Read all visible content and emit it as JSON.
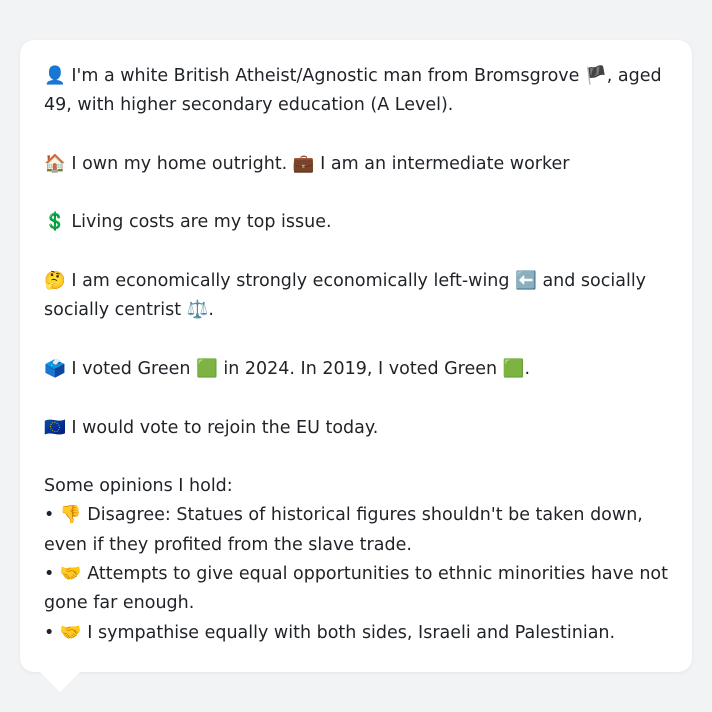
{
  "profile": {
    "intro": {
      "emoji": "👤",
      "text_before_flag": " I'm a white British Atheist/Agnostic man from Bromsgrove ",
      "flag": "🏴",
      "text_after_flag": ", aged 49, with higher secondary education (A Level)."
    },
    "home": {
      "emoji_house": "🏠",
      "text_house": " I own my home outright. ",
      "emoji_work": "💼",
      "text_work": " I am an intermediate worker"
    },
    "issue": {
      "emoji": "💲",
      "text": " Living costs are my top issue."
    },
    "politics": {
      "emoji": "🤔",
      "text_before": " I am economically strongly economically left-wing ",
      "emoji_left": "⬅️",
      "text_middle": " and socially socially centrist ",
      "emoji_scale": "⚖️",
      "text_end": "."
    },
    "vote": {
      "emoji": "🗳️",
      "text_1": " I voted Green ",
      "emoji_green_1": "🟩",
      "text_2": " in 2024. In 2019, I voted Green ",
      "emoji_green_2": "🟩",
      "text_3": "."
    },
    "eu": {
      "emoji": "🇪🇺",
      "text": " I would vote to rejoin the EU today."
    },
    "opinions": {
      "heading": "Some opinions I hold:",
      "items": [
        {
          "bullet": "• ",
          "emoji": "👎",
          "text": " Disagree: Statues of historical figures shouldn't be taken down, even if they profited from the slave trade."
        },
        {
          "bullet": "• ",
          "emoji": "🤝",
          "text": " Attempts to give equal opportunities to ethnic minorities have not gone far enough."
        },
        {
          "bullet": "• ",
          "emoji": "🤝",
          "text": " I sympathise equally with both sides, Israeli and Palestinian."
        }
      ]
    }
  }
}
